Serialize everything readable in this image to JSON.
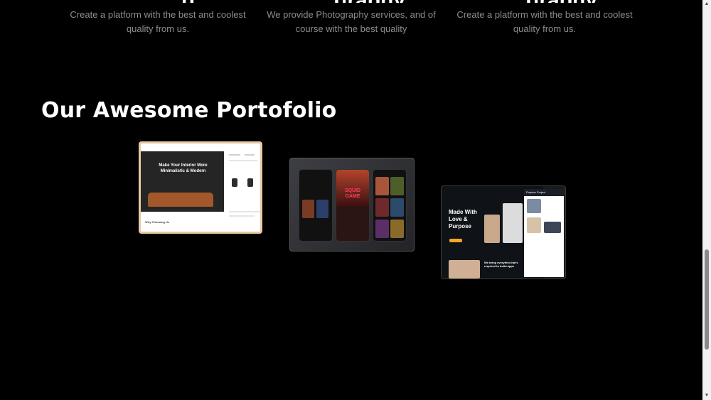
{
  "services": [
    {
      "title_fragment": "p",
      "description": "Create a platform with the best and coolest quality from us."
    },
    {
      "title_fragment": "graphy",
      "description": "We provide Photography services, and of course with the best quality"
    },
    {
      "title_fragment": "graphy",
      "description": "Create a platform with the best and coolest quality from us."
    }
  ],
  "portfolio": {
    "title": "Our Awesome Portofolio",
    "items": [
      {
        "name": "interior-website",
        "hero_text": "Make Your Interior More Minimalistic & Modern",
        "footer_text": "Why Choosing Us"
      },
      {
        "name": "movie-app",
        "poster_text": "SQUID GAME"
      },
      {
        "name": "agency-website",
        "headline": "Made With Love & Purpose",
        "subtext": "We bring everythin that's required to build apps",
        "side_label": "Popular Project"
      }
    ]
  },
  "scrollbar": {
    "up_arrow": "▲",
    "down_arrow": "▼"
  }
}
